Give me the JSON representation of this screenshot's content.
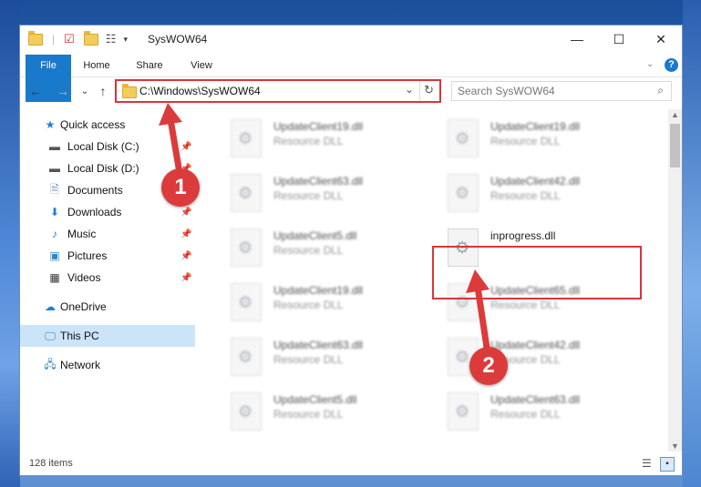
{
  "window": {
    "title": "SysWOW64"
  },
  "ribbon": {
    "tabs": [
      "File",
      "Home",
      "Share",
      "View"
    ]
  },
  "address": {
    "path": "C:\\Windows\\SysWOW64"
  },
  "search": {
    "placeholder": "Search SysWOW64"
  },
  "sidebar": {
    "quick_access": "Quick access",
    "items": [
      {
        "label": "Local Disk (C:)",
        "icon": "drive-icon"
      },
      {
        "label": "Local Disk (D:)",
        "icon": "drive-icon"
      },
      {
        "label": "Documents",
        "icon": "documents-icon"
      },
      {
        "label": "Downloads",
        "icon": "downloads-icon"
      },
      {
        "label": "Music",
        "icon": "music-icon"
      },
      {
        "label": "Pictures",
        "icon": "pictures-icon"
      },
      {
        "label": "Videos",
        "icon": "videos-icon"
      }
    ],
    "onedrive": "OneDrive",
    "this_pc": "This PC",
    "network": "Network"
  },
  "files": [
    {
      "name": "UpdateClient19.dll",
      "type": "Resource DLL"
    },
    {
      "name": "UpdateClient19.dll",
      "type": "Resource DLL"
    },
    {
      "name": "UpdateClient63.dll",
      "type": "Resource DLL"
    },
    {
      "name": "UpdateClient42.dll",
      "type": "Resource DLL"
    },
    {
      "name": "UpdateClient5.dll",
      "type": "Resource DLL"
    },
    {
      "name": "inprogress.dll",
      "type": ""
    },
    {
      "name": "UpdateClient19.dll",
      "type": "Resource DLL"
    },
    {
      "name": "UpdateClient65.dll",
      "type": "Resource DLL"
    },
    {
      "name": "UpdateClient63.dll",
      "type": "Resource DLL"
    },
    {
      "name": "UpdateClient42.dll",
      "type": "Resource DLL"
    },
    {
      "name": "UpdateClient5.dll",
      "type": "Resource DLL"
    },
    {
      "name": "UpdateClient63.dll",
      "type": "Resource DLL"
    }
  ],
  "status": {
    "item_count": "128 items"
  },
  "markers": [
    "1",
    "2"
  ],
  "colors": {
    "accent": "#1979ca",
    "highlight": "#d9353a"
  }
}
